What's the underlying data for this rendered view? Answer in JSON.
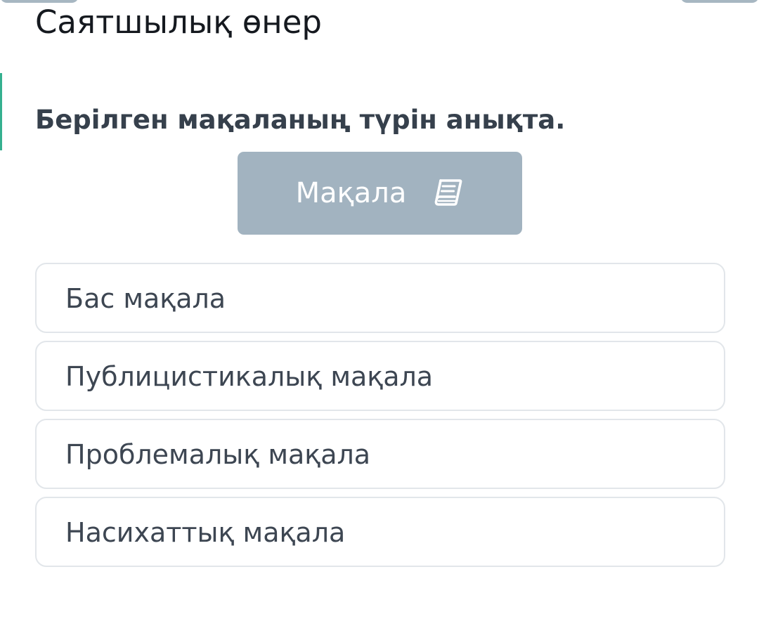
{
  "header": {
    "title": "Саятшылық өнер"
  },
  "question": {
    "text": "Берілген мақаланың түрін анықта."
  },
  "given": {
    "label": "Мақала",
    "icon": "book-icon"
  },
  "options": [
    {
      "label": "Бас мақала"
    },
    {
      "label": "Публицистикалық мақала"
    },
    {
      "label": "Проблемалық мақала"
    },
    {
      "label": "Насихаттық мақала"
    }
  ],
  "colors": {
    "given_background": "#a2b3c0",
    "option_border": "#e2e6ea",
    "accent": "#35b08f"
  }
}
